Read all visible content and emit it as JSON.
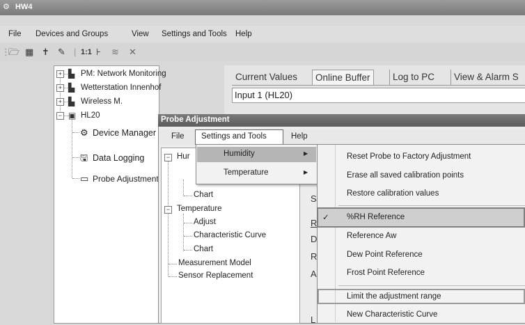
{
  "app": {
    "title": "HW4"
  },
  "menu": [
    "File",
    "Devices and Groups",
    "View",
    "Settings and Tools",
    "Help"
  ],
  "toolbar": {
    "ratio_label": "1:1"
  },
  "tree": {
    "items": [
      {
        "label": "PM: Network Monitoring",
        "icon": "network-device-icon"
      },
      {
        "label": "Wetterstation Innenhof",
        "icon": "network-device-icon"
      },
      {
        "label": "Wireless M.",
        "icon": "network-device-icon"
      },
      {
        "label": "HL20",
        "icon": "logger-device-icon"
      },
      {
        "label": "Device Manager",
        "icon": "gear-icon"
      },
      {
        "label": "Data Logging",
        "icon": "save-icon"
      },
      {
        "label": "Probe Adjustment",
        "icon": "probe-icon"
      }
    ]
  },
  "tabs": [
    "Current Values",
    "Online Buffer",
    "Log to PC",
    "View & Alarm S"
  ],
  "input_value": "Input 1  (HL20)",
  "dialog": {
    "title": "Probe Adjustment",
    "menu": [
      "File",
      "Settings and Tools",
      "Help"
    ],
    "tree": {
      "humidity_partial": "Hur",
      "humidity_chart": "Chart",
      "temperature": "Temperature",
      "temperature_children": [
        "Adjust",
        "Characteristic Curve",
        "Chart"
      ],
      "measurement_model": "Measurement Model",
      "sensor_replacement": "Sensor Replacement"
    },
    "background_letters": [
      "S",
      "R",
      "D",
      "R",
      "A",
      "L"
    ]
  },
  "submenu": {
    "items": [
      {
        "label": "Humidity",
        "arrow": "▶"
      },
      {
        "label": "Temperature",
        "arrow": "▶"
      }
    ]
  },
  "submenu2": {
    "items": [
      "Reset Probe to Factory Adjustment",
      "Erase all saved calibration points",
      "Restore calibration values",
      "%RH Reference",
      "Reference Aw",
      "Dew Point Reference",
      "Frost Point Reference",
      "Limit the adjustment range",
      "New Characteristic Curve"
    ],
    "checkmark": "✓"
  }
}
